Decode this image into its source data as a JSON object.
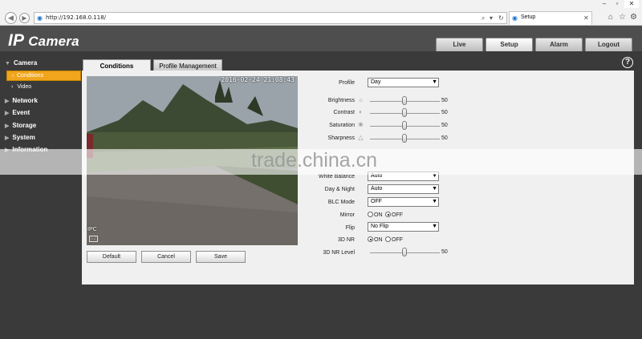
{
  "browser": {
    "url": "http://192.168.0.118/",
    "tab_title": "Setup",
    "back_icon": "back-arrow-icon",
    "forward_icon": "forward-arrow-icon"
  },
  "header": {
    "logo_ip": "IP",
    "logo_camera": "Camera",
    "tabs": [
      {
        "label": "Live"
      },
      {
        "label": "Setup"
      },
      {
        "label": "Alarm"
      },
      {
        "label": "Logout"
      }
    ]
  },
  "sidebar": {
    "camera": "Camera",
    "conditions": "Conditions",
    "video": "Video",
    "network": "Network",
    "event": "Event",
    "storage": "Storage",
    "system": "System",
    "information": "Information"
  },
  "content_tabs": {
    "conditions": "Conditions",
    "profile_management": "Profile Management"
  },
  "video": {
    "osd_time": "2016-02-24 21:08:43",
    "osd_name": "IPC"
  },
  "buttons": {
    "default": "Default",
    "cancel": "Cancel",
    "save": "Save"
  },
  "settings": {
    "profile": {
      "label": "Profile",
      "value": "Day"
    },
    "brightness": {
      "label": "Brightness",
      "value": "50",
      "level": 0.5
    },
    "contrast": {
      "label": "Contrast",
      "value": "50",
      "level": 0.5
    },
    "saturation": {
      "label": "Saturation",
      "value": "50",
      "level": 0.5
    },
    "sharpness": {
      "label": "Sharpness",
      "value": "50",
      "level": 0.5
    },
    "white_balance": {
      "label": "White Balance",
      "value": "Auto"
    },
    "day_night": {
      "label": "Day & Night",
      "value": "Auto"
    },
    "blc_mode": {
      "label": "BLC Mode",
      "value": "OFF"
    },
    "mirror": {
      "label": "Mirror",
      "on": "ON",
      "off": "OFF",
      "selected": "OFF"
    },
    "flip": {
      "label": "Flip",
      "value": "No Flip"
    },
    "nr3d": {
      "label": "3D NR",
      "on": "ON",
      "off": "OFF",
      "selected": "ON"
    },
    "nr3d_level": {
      "label": "3D NR Level",
      "value": "50",
      "level": 0.5
    }
  },
  "watermark": "trade.china.cn",
  "colors": {
    "accent": "#f0a51c",
    "header_bg": "#4e4e4e",
    "panel_bg": "#f0f0f0"
  }
}
